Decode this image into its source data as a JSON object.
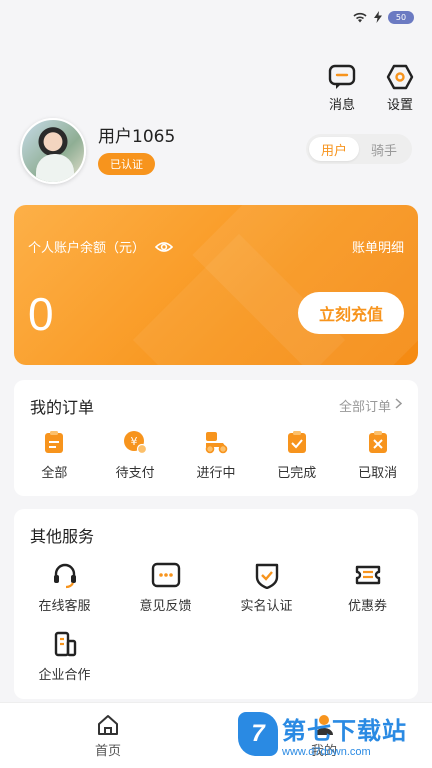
{
  "status_bar": {
    "battery": "50"
  },
  "top_actions": [
    {
      "label": "消息",
      "icon": "message-icon"
    },
    {
      "label": "设置",
      "icon": "settings-icon"
    }
  ],
  "profile": {
    "username": "用户1065",
    "verified": "已认证",
    "roles": [
      {
        "label": "用户",
        "active": true
      },
      {
        "label": "骑手",
        "active": false
      }
    ]
  },
  "balance": {
    "label": "个人账户余额（元）",
    "bill_link": "账单明细",
    "value": "0",
    "recharge": "立刻充值"
  },
  "orders": {
    "title": "我的订单",
    "more": "全部订单",
    "items": [
      {
        "label": "全部",
        "icon": "all-orders-icon"
      },
      {
        "label": "待支付",
        "icon": "pending-payment-icon"
      },
      {
        "label": "进行中",
        "icon": "in-progress-icon"
      },
      {
        "label": "已完成",
        "icon": "completed-icon"
      },
      {
        "label": "已取消",
        "icon": "cancelled-icon"
      }
    ]
  },
  "services": {
    "title": "其他服务",
    "items": [
      {
        "label": "在线客服",
        "icon": "headset-icon"
      },
      {
        "label": "意见反馈",
        "icon": "feedback-icon"
      },
      {
        "label": "实名认证",
        "icon": "id-verify-icon"
      },
      {
        "label": "优惠券",
        "icon": "coupon-icon"
      },
      {
        "label": "企业合作",
        "icon": "enterprise-icon"
      }
    ]
  },
  "tabbar": [
    {
      "label": "首页",
      "icon": "home-icon"
    },
    {
      "label": "我的",
      "icon": "profile-icon"
    }
  ],
  "watermark": {
    "name": "第七下载站",
    "url": "www.d7down.com"
  },
  "colors": {
    "accent": "#f7941d",
    "background": "#f5f5f7"
  }
}
